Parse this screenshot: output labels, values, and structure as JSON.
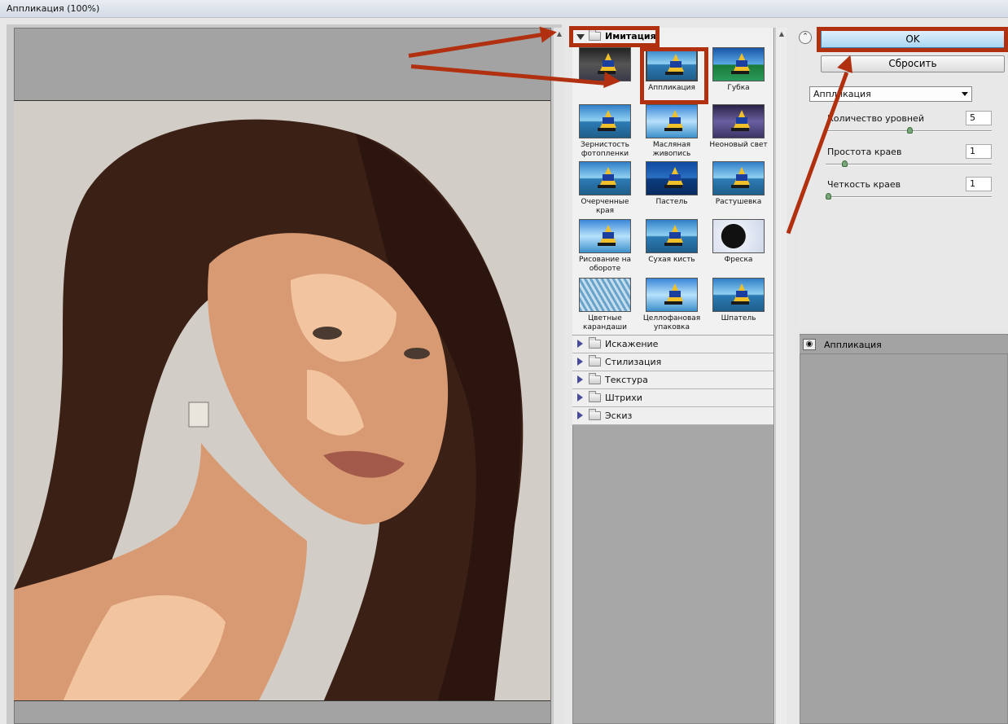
{
  "window": {
    "title": "Аппликация (100%)"
  },
  "gallery": {
    "open_category": "Имитация",
    "thumbnails": [
      {
        "label": "",
        "style": "dark"
      },
      {
        "label": "Аппликация",
        "style": "sel"
      },
      {
        "label": "Губка",
        "style": "sponge"
      },
      {
        "label": "Зернистость фотопленки",
        "style": "plain"
      },
      {
        "label": "Масляная живопись",
        "style": "glass"
      },
      {
        "label": "Неоновый свет",
        "style": "neon"
      },
      {
        "label": "Очерченные края",
        "style": "plain"
      },
      {
        "label": "Пастель",
        "style": "blur"
      },
      {
        "label": "Растушевка",
        "style": "plain"
      },
      {
        "label": "Рисование на обороте",
        "style": "glass"
      },
      {
        "label": "Сухая кисть",
        "style": "plain"
      },
      {
        "label": "Фреска",
        "style": "fresco"
      },
      {
        "label": "Цветные карандаши",
        "style": "pencil"
      },
      {
        "label": "Целлофановая упаковка",
        "style": "glass"
      },
      {
        "label": "Шпатель",
        "style": "plain"
      }
    ],
    "categories": [
      "Искажение",
      "Стилизация",
      "Текстура",
      "Штрихи",
      "Эскиз"
    ]
  },
  "buttons": {
    "ok": "OK",
    "reset": "Сбросить"
  },
  "filter_select": {
    "value": "Аппликация"
  },
  "params": [
    {
      "label": "Количество уровней",
      "value": "5",
      "level": 0.5
    },
    {
      "label": "Простота краев",
      "value": "1",
      "level": 0.1
    },
    {
      "label": "Четкость краев",
      "value": "1",
      "level": 0.0
    }
  ],
  "layers": [
    {
      "label": "Аппликация"
    }
  ],
  "colors": {
    "annotation": "#b0300f",
    "hair": "#3b2016",
    "skin": "#d89a72",
    "skin_light": "#f2c4a0",
    "bg": "#d3cdc7"
  },
  "icons": {
    "eye": "eye-icon",
    "folder": "folder-icon",
    "collapse": "double-chevron-up-icon"
  }
}
